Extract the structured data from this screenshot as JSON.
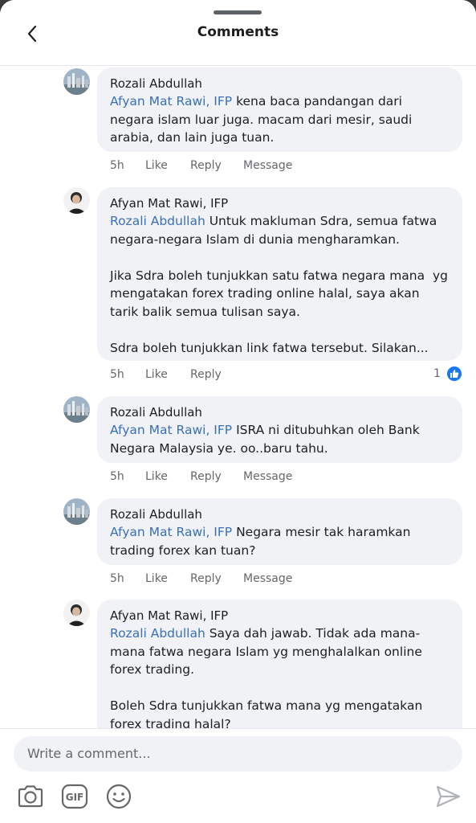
{
  "header": {
    "title": "Comments",
    "back_icon": "chevron-left-icon"
  },
  "comments": [
    {
      "author": "Rozali Abdullah",
      "mention": "Afyan Mat Rawi, IFP",
      "text": " kena baca pandangan dari negara islam luar juga. macam dari mesir, saudi arabia, dan lain juga tuan.",
      "time": "5h",
      "like": "Like",
      "reply": "Reply",
      "message": "Message"
    },
    {
      "author": "Afyan Mat Rawi, IFP",
      "mention": "Rozali Abdullah",
      "text": " Untuk makluman Sdra, semua fatwa negara-negara Islam di dunia mengharamkan.\n\nJika Sdra boleh tunjukkan satu fatwa negara mana  yg mengatakan forex trading online halal, saya akan tarik balik semua tulisan saya.\n\nSdra boleh tunjukkan link fatwa tersebut. Silakan...",
      "time": "5h",
      "like": "Like",
      "reply": "Reply",
      "reaction_count": "1"
    },
    {
      "author": "Rozali Abdullah",
      "mention": "Afyan Mat Rawi, IFP",
      "text": " ISRA ni ditubuhkan oleh Bank Negara Malaysia ye. oo..baru tahu.",
      "time": "5h",
      "like": "Like",
      "reply": "Reply",
      "message": "Message"
    },
    {
      "author": "Rozali Abdullah",
      "mention": "Afyan Mat Rawi, IFP",
      "text": " Negara mesir tak haramkan trading forex kan tuan?",
      "time": "5h",
      "like": "Like",
      "reply": "Reply",
      "message": "Message"
    },
    {
      "author": "Afyan Mat Rawi, IFP",
      "mention": "Rozali Abdullah",
      "text": " Saya dah jawab. Tidak ada mana-mana fatwa negara Islam yg menghalalkan online forex trading.\n\nBoleh Sdra tunjukkan fatwa mana yg mengatakan forex trading halal?"
    }
  ],
  "composer": {
    "placeholder": "Write a comment...",
    "tools": [
      "camera-icon",
      "gif-icon",
      "emoji-icon"
    ],
    "send_icon": "send-icon"
  },
  "colors": {
    "mention": "#3b6fb6",
    "like_blue": "#1877f2",
    "bubble": "#f0f2f5"
  }
}
